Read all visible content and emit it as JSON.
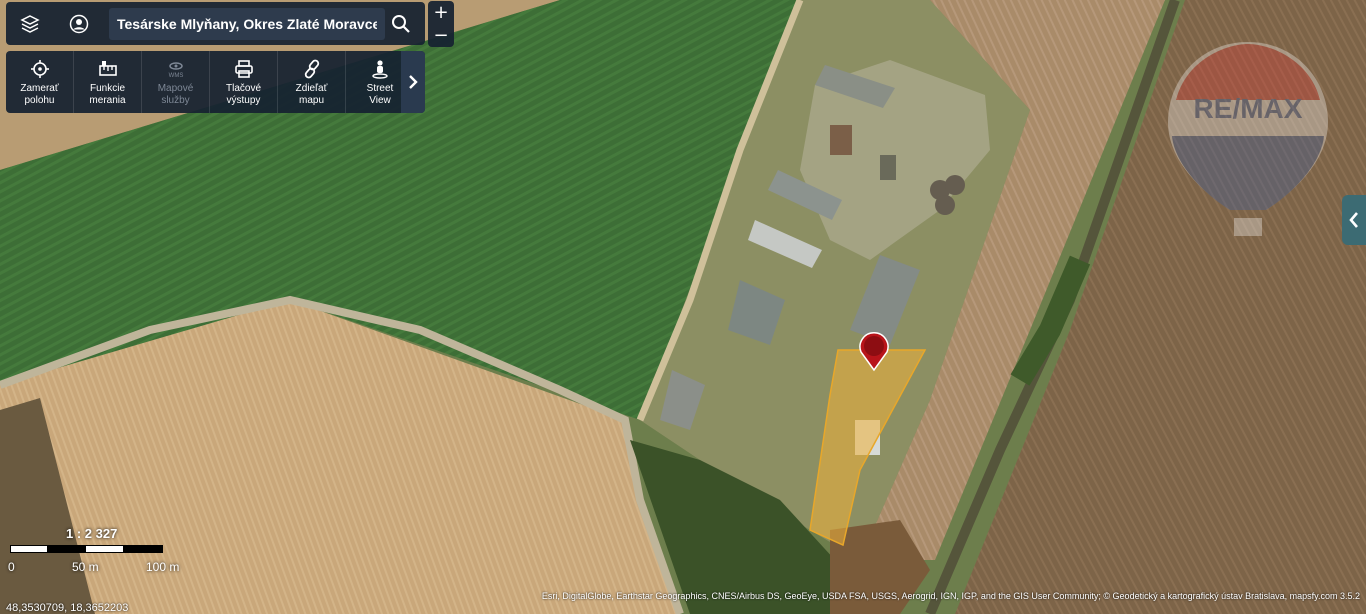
{
  "search": {
    "value": "Tesárske Mlyňany, Okres Zlaté Moravce, N"
  },
  "zoom": {
    "in_label": "+",
    "out_label": "−"
  },
  "toolbar": {
    "tools": [
      {
        "label": "Zamerať\npolohu"
      },
      {
        "label": "Funkcie\nmerania"
      },
      {
        "label": "Mapové\nslužby",
        "sub": "WMS"
      },
      {
        "label": "Tlačové\nvýstupy"
      },
      {
        "label": "Zdieľať\nmapu"
      },
      {
        "label": "Street\nView"
      }
    ]
  },
  "scale": {
    "ratio": "1 : 2 327",
    "ticks": [
      "0",
      "50 m",
      "100 m"
    ]
  },
  "coordinates": "48,3530709, 18,3652203",
  "attribution": "Esri, DigitalGlobe, Earthstar Geographics, CNES/Airbus DS, GeoEye, USDA FSA, USGS, Aerogrid, IGN, IGP, and the GIS User Community; © Geodetický a kartografický ústav Bratislava, mapsfy.com 3.5.2",
  "watermark": {
    "text": "RE/MAX"
  },
  "colors": {
    "panel": "#162130",
    "parcel_fill": "#f0b33a",
    "pin": "#b8141a"
  }
}
